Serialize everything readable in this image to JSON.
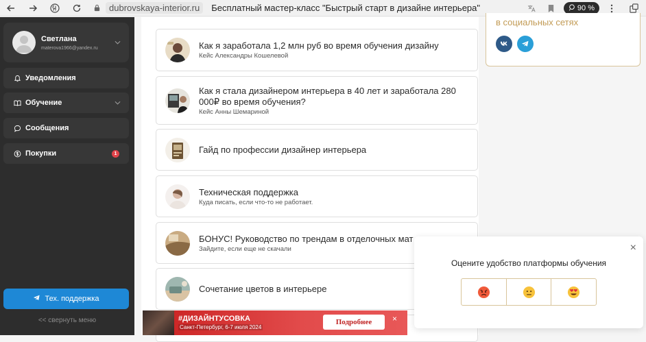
{
  "browser": {
    "domain": "dubrovskaya-interior.ru",
    "page_title": "Бесплатный мастер-класс \"Быстрый старт в дизайне интерьера\"",
    "zoom": "90 %"
  },
  "sidebar": {
    "user": {
      "name": "Светлана",
      "email": "materova1966@yandex.ru"
    },
    "items": [
      {
        "label": "Уведомления",
        "icon": "bell-icon"
      },
      {
        "label": "Обучение",
        "icon": "book-icon"
      },
      {
        "label": "Сообщения",
        "icon": "chat-icon"
      },
      {
        "label": "Покупки",
        "icon": "dollar-icon",
        "badge": "1"
      }
    ],
    "support_label": "Тех. поддержка",
    "collapse_label": "<< свернуть меню"
  },
  "cards": [
    {
      "title": "Как я заработала 1,2 млн руб во время обучения дизайну",
      "subtitle": "Кейс Александры Кошелевой"
    },
    {
      "title": "Как я стала дизайнером интерьера в 40 лет и заработала 280 000₽ во время обучения?",
      "subtitle": "Кейс Анны Шемариной"
    },
    {
      "title": "Гайд по профессии дизайнер интерьера",
      "subtitle": ""
    },
    {
      "title": "Техническая поддержка",
      "subtitle": "Куда писать, если что-то не работает."
    },
    {
      "title": "БОНУС! Руководство по трендам в отделочных мат",
      "subtitle": "Зайдите, если еще не скачали"
    },
    {
      "title": "Сочетание цветов в интерьере",
      "subtitle": ""
    }
  ],
  "social": {
    "title": "в социальных сетях"
  },
  "ad": {
    "tag": "#ДИЗАЙНТУСОВКА",
    "city": "Санкт-Петербург, 6-7 июля 2024",
    "button": "Подробнее",
    "close": "×"
  },
  "rating_popup": {
    "title": "Оцените удобство платформы обучения",
    "close": "×"
  },
  "colors": {
    "sidebar_bg": "#2d2d2d",
    "accent_blue": "#1e88d6",
    "gold": "#c29b55",
    "badge_red": "#e0434a"
  }
}
